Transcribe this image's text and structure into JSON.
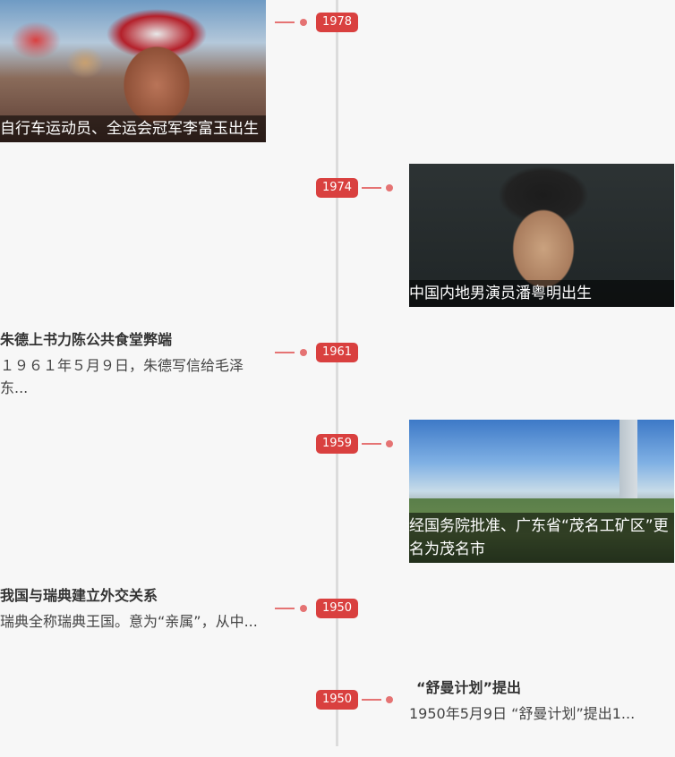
{
  "timeline": [
    {
      "year": "1978",
      "side": "left",
      "type": "image",
      "caption": "自行车运动员、全运会冠军李富玉出生",
      "image": "cyclist-photo"
    },
    {
      "year": "1974",
      "side": "right",
      "type": "image",
      "caption": "中国内地男演员潘粤明出生",
      "image": "actor-portrait-photo"
    },
    {
      "year": "1961",
      "side": "left",
      "type": "text",
      "title": "朱德上书力陈公共食堂弊端",
      "desc": "１９６１年５月９日，朱德写信给毛泽东..."
    },
    {
      "year": "1959",
      "side": "right",
      "type": "image",
      "caption": "经国务院批准、广东省“茂名工矿区”更名为茂名市",
      "image": "city-aerial-photo"
    },
    {
      "year": "1950",
      "side": "left",
      "type": "text",
      "title": "我国与瑞典建立外交关系",
      "desc": "瑞典全称瑞典王国。意为“亲属”，从中..."
    },
    {
      "year": "1950",
      "side": "right",
      "type": "text",
      "title": "“舒曼计划”提出",
      "desc": "1950年5月9日 “舒曼计划”提出1..."
    }
  ],
  "colors": {
    "accent": "#d9403f",
    "connector": "#e57373",
    "axis": "#dcdcdc",
    "background": "#f7f7f7"
  }
}
